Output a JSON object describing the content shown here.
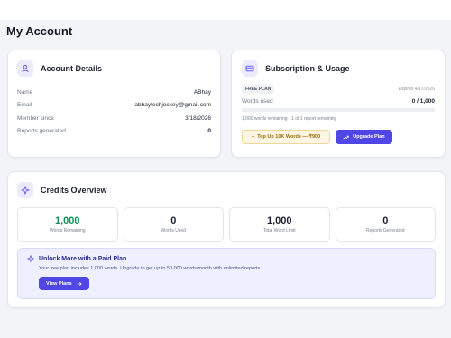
{
  "page": {
    "title": "My Account"
  },
  "account": {
    "title": "Account Details",
    "rows": [
      {
        "label": "Name",
        "value": "ABhay"
      },
      {
        "label": "Email",
        "value": "abhaytechjockey@gmail.com"
      },
      {
        "label": "Member since",
        "value": "3/18/2026"
      },
      {
        "label": "Reports generated",
        "value": "0"
      }
    ]
  },
  "subscription": {
    "title": "Subscription & Usage",
    "plan_badge": "FREE PLAN",
    "expires": "Expires 4/17/2026",
    "words_label": "Words used",
    "words_value": "0 / 1,000",
    "usage_fraction": 0,
    "remaining": "1,000 words remaining · 1 of 1 report remaining",
    "topup_label": "Top Up 10K Words — ₹900",
    "topup_prefix": "+",
    "upgrade_label": "Upgrade Plan"
  },
  "credits": {
    "title": "Credits Overview",
    "stats": [
      {
        "value": "1,000",
        "label": "Words Remaining"
      },
      {
        "value": "0",
        "label": "Words Used"
      },
      {
        "value": "1,000",
        "label": "Total Word Limit"
      },
      {
        "value": "0",
        "label": "Reports Generated"
      }
    ],
    "promo_title": "Unlock More with a Paid Plan",
    "promo_text": "Your free plan includes 1,000 words. Upgrade to get up to 50,000 words/month with unlimited reports.",
    "view_plans_label": "View Plans"
  },
  "colors": {
    "accent": "#4f46e5",
    "highlight_number": "#14915a",
    "topup_bg": "#fdf6e3",
    "promo_bg": "#eef0ff"
  },
  "icons": {
    "account": "user-icon",
    "subscription": "credit-card-icon",
    "credits": "sparkle-icon",
    "promo": "sparkle-icon",
    "upgrade": "trending-up-icon",
    "view_plans": "arrow-right-icon"
  }
}
